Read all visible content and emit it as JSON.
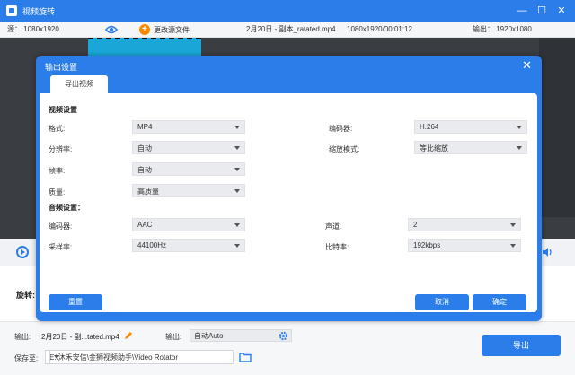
{
  "window": {
    "title": "视频旋转",
    "minimize": "—",
    "maximize": "☐",
    "close": "✕"
  },
  "infobar": {
    "source_label": "源：",
    "source_res": "1080x1920",
    "change_source": "更改源文件",
    "file_name": "2月20日 - 副本_ratated.mp4",
    "dims_duration": "1080x1920/00:01:12",
    "output_label": "输出：",
    "output_res": "1920x1080"
  },
  "rotate_label": "旋转:",
  "bottom": {
    "output_label": "输出:",
    "output_file": "2月20日 - 副...tated.mp4",
    "format_label": "输出:",
    "format_value": "自动Auto",
    "save_label": "保存至:",
    "save_path": "E:\\沐禾安信\\金狮视频助手\\Video Rotator",
    "export_button": "导出"
  },
  "modal": {
    "title": "输出设置",
    "tab": "导出视频",
    "video_section": "视频设置",
    "audio_section": "音频设置：",
    "video_fields": [
      {
        "label": "格式:",
        "value": "MP4"
      },
      {
        "label": "分辨率:",
        "value": "自动"
      },
      {
        "label": "帧率:",
        "value": "自动"
      },
      {
        "label": "质量:",
        "value": "高质量"
      }
    ],
    "video_fields_right": [
      {
        "label": "编码器:",
        "value": "H.264"
      },
      {
        "label": "缩放模式:",
        "value": "等比缩放"
      }
    ],
    "audio_fields": [
      {
        "label": "编码器:",
        "value": "AAC"
      },
      {
        "label": "采样率:",
        "value": "44100Hz"
      }
    ],
    "audio_fields_right": [
      {
        "label": "声道:",
        "value": "2"
      },
      {
        "label": "比特率:",
        "value": "192kbps"
      }
    ],
    "reset_button": "重置",
    "cancel_button": "取消",
    "ok_button": "确定"
  },
  "colors": {
    "accent": "#2b7de9",
    "orange": "#ff8a00",
    "preview_bg": "#3a3d42"
  }
}
